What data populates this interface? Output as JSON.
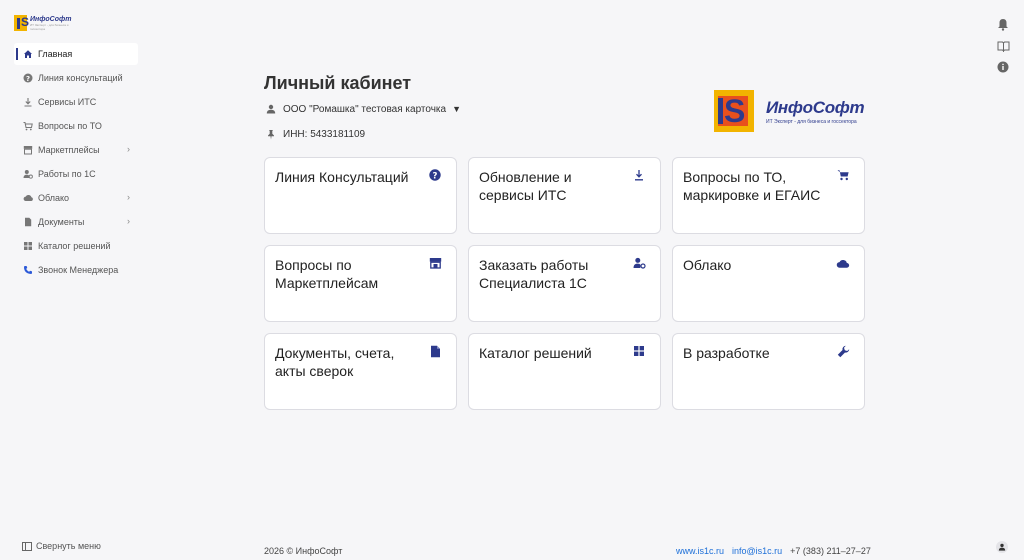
{
  "brand": {
    "name": "ИнфоСофт",
    "tagline": "ИТ Эксперт - для бизнеса и госсектора"
  },
  "sidebar": {
    "items": [
      {
        "label": "Главная",
        "icon": "home-icon",
        "active": true,
        "has_submenu": false
      },
      {
        "label": "Линия консультаций",
        "icon": "help-circle-icon",
        "active": false,
        "has_submenu": false
      },
      {
        "label": "Сервисы ИТС",
        "icon": "download-icon",
        "active": false,
        "has_submenu": false
      },
      {
        "label": "Вопросы по ТО",
        "icon": "cart-icon",
        "active": false,
        "has_submenu": false
      },
      {
        "label": "Маркетплейсы",
        "icon": "store-icon",
        "active": false,
        "has_submenu": true
      },
      {
        "label": "Работы по 1С",
        "icon": "user-gear-icon",
        "active": false,
        "has_submenu": false
      },
      {
        "label": "Облако",
        "icon": "cloud-icon",
        "active": false,
        "has_submenu": true
      },
      {
        "label": "Документы",
        "icon": "document-icon",
        "active": false,
        "has_submenu": true
      },
      {
        "label": "Каталог решений",
        "icon": "grid-icon",
        "active": false,
        "has_submenu": false
      },
      {
        "label": "Звонок Менеджера",
        "icon": "phone-icon",
        "active": false,
        "has_submenu": false
      }
    ],
    "collapse_label": "Свернуть меню"
  },
  "header": {
    "title": "Личный кабинет",
    "organization": "ООО \"Ромашка\" тестовая карточка",
    "inn": "ИНН: 5433181109"
  },
  "cards": [
    {
      "label": "Линия Консультаций",
      "icon": "help-circle-icon"
    },
    {
      "label": "Обновление и сервисы ИТС",
      "icon": "download-icon"
    },
    {
      "label": "Вопросы по ТО, маркировке и ЕГАИС",
      "icon": "cart-icon"
    },
    {
      "label": "Вопросы по Маркетплейсам",
      "icon": "store-icon"
    },
    {
      "label": "Заказать работы Специалиста 1С",
      "icon": "user-gear-icon"
    },
    {
      "label": "Облако",
      "icon": "cloud-icon"
    },
    {
      "label": "Документы, счета, акты сверок",
      "icon": "document-icon"
    },
    {
      "label": "Каталог решений",
      "icon": "grid-icon"
    },
    {
      "label": "В разработке",
      "icon": "wrench-icon"
    }
  ],
  "footer": {
    "copyright": "2026 © ИнфоСофт",
    "site": "www.is1c.ru",
    "email": "info@is1c.ru",
    "phone": "+7 (383) 211–27–27"
  },
  "colors": {
    "accent": "#2d3a8c",
    "brand_yellow": "#f2b400",
    "brand_red": "#e8501d",
    "link": "#1d6fd8"
  }
}
